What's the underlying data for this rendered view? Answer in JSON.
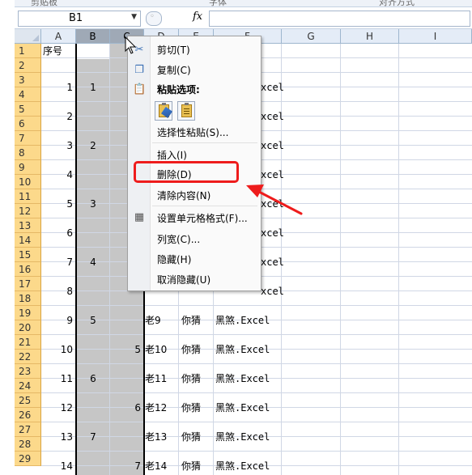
{
  "ribbon": {
    "group_labels": [
      "剪贴板",
      "字体",
      "对齐方式"
    ]
  },
  "formula_bar": {
    "name_box": "B1",
    "fx_label": "fx",
    "formula": ""
  },
  "columns": [
    "A",
    "B",
    "C",
    "D",
    "E",
    "F",
    "G",
    "H",
    "I"
  ],
  "rows": [
    "1",
    "2",
    "3",
    "4",
    "5",
    "6",
    "7",
    "8",
    "9",
    "10",
    "11",
    "12",
    "13",
    "14",
    "15",
    "16",
    "17",
    "18",
    "19",
    "20",
    "21",
    "22",
    "23",
    "24",
    "25",
    "26",
    "27",
    "28",
    "29"
  ],
  "cells": {
    "header": "序号",
    "col_a": [
      "1",
      "2",
      "3",
      "4",
      "5",
      "6",
      "7",
      "8",
      "9",
      "10",
      "11",
      "12",
      "13",
      "14"
    ],
    "col_b": [
      "1",
      "2",
      "3",
      "4",
      "5",
      "6",
      "7"
    ],
    "col_c": [
      "5",
      "6",
      "7"
    ],
    "col_d": [
      "老9",
      "老10",
      "老11",
      "老12",
      "老13",
      "老14"
    ],
    "col_e": [
      "你猜",
      "你猜",
      "你猜",
      "你猜",
      "你猜",
      "你猜"
    ],
    "col_f_visible": [
      "xcel",
      "xcel",
      "xcel",
      "xcel",
      "xcel",
      "xcel",
      "xcel",
      "xcel"
    ],
    "col_f": [
      "黑煞.Excel",
      "黑煞.Excel",
      "黑煞.Excel",
      "黑煞.Excel",
      "黑煞.Excel",
      "黑煞.Excel"
    ]
  },
  "context_menu": {
    "cut": "剪切(T)",
    "copy": "复制(C)",
    "paste_options": "粘贴选项:",
    "paste_special": "选择性粘贴(S)...",
    "insert": "插入(I)",
    "delete": "删除(D)",
    "clear_contents": "清除内容(N)",
    "format_cells": "设置单元格格式(F)...",
    "column_width": "列宽(C)...",
    "hide": "隐藏(H)",
    "unhide": "取消隐藏(U)"
  },
  "colors": {
    "accent_red": "#ee1c1c",
    "row_header": "#fcd98b",
    "selection": "#c6c6c6"
  }
}
